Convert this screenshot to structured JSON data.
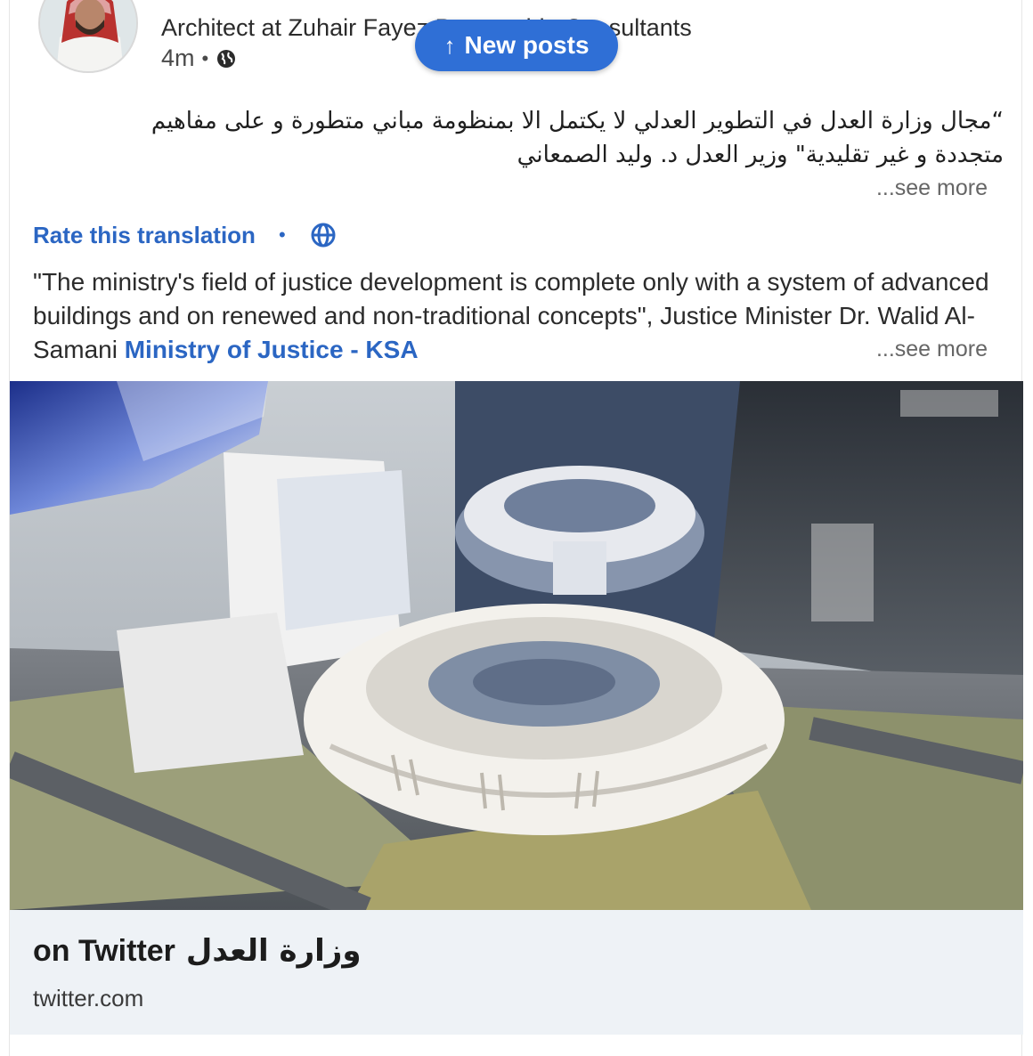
{
  "post": {
    "author_headline": "Architect at Zuhair Fayez Partnership Consultants",
    "timestamp": "4m",
    "separator_dot": "•",
    "visibility_icon": "globe-icon",
    "arabic_line1": "“مجال وزارة العدل في التطوير العدلي لا يكتمل الا بمنظومة مباني متطورة و على مفاهيم",
    "arabic_line2": "متجددة و غير تقليدية\" وزير العدل د. وليد الصمعاني",
    "see_more_1": "...see more",
    "rate_translation": "Rate this translation",
    "translate_dot": "•",
    "translation_text": "\"The ministry's field of justice development is complete only with a system of advanced buildings and on renewed and non-traditional concepts\", Justice Minister Dr. Walid Al-Samani",
    "mention": "Ministry of Justice - KSA",
    "see_more_2": "...see more"
  },
  "new_posts": {
    "label": "New posts",
    "icon": "arrow-up-icon"
  },
  "link_preview": {
    "title_ar": "وزارة العدل",
    "title_en": "on Twitter",
    "domain": "twitter.com"
  },
  "colors": {
    "accent_blue": "#2b66c3",
    "pill_blue": "#2f6fd6",
    "preview_bg": "#eef2f6"
  }
}
